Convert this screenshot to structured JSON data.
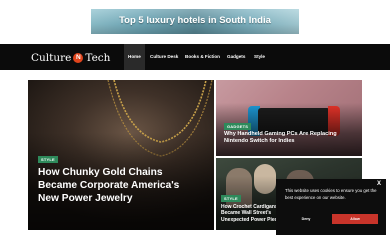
{
  "ad": {
    "text": "Top 5 luxury hotels in South India"
  },
  "logo": {
    "left": "Culture",
    "middle": "N",
    "right": "Tech"
  },
  "nav": [
    "Home",
    "Culture Desk",
    "Books & Fiction",
    "Gadgets",
    "Style"
  ],
  "hero": {
    "tag": "STYLE",
    "title": "How Chunky Gold Chains Became Corporate America's New Power Jewelry"
  },
  "card_top": {
    "tag": "GADGETS",
    "title": "Why Handheld Gaming PCs Are Replacing Nintendo Switch for Indies"
  },
  "card_bottom": {
    "tag": "STYLE",
    "title": "How Crochet Cardigans Became Wall Street's Unexpected Power Piece"
  },
  "cookie": {
    "close": "X",
    "text": "This website uses cookies to ensure you get the best experience on our website.",
    "deny": "Deny",
    "allow": "Allow"
  },
  "colors": {
    "nav_bg": "#0b0b0b",
    "tag_green": "#2e8a5b",
    "logo_accent": "#e0441c",
    "allow_red": "#c8342a"
  }
}
